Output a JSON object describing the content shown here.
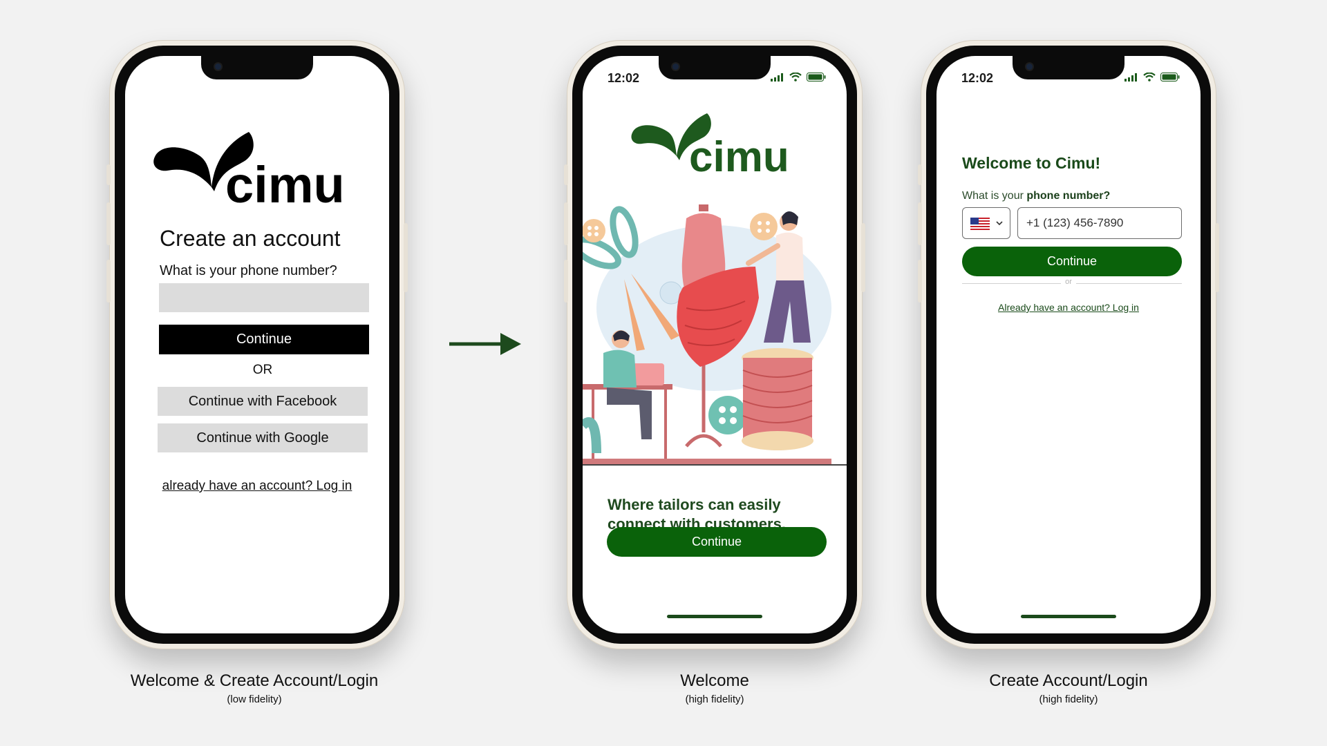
{
  "colors": {
    "brand_green": "#0a620a",
    "dark_green": "#1a4a1a",
    "background": "#f2f2f2"
  },
  "screens": {
    "lowfi": {
      "logo_text": "cimu",
      "title": "Create an account",
      "question": "What is your phone number?",
      "continue_label": "Continue",
      "or_label": "OR",
      "facebook_label": "Continue with Facebook",
      "google_label": "Continue with Google",
      "login_link": "already have an account? Log in",
      "caption": "Welcome & Create Account/Login",
      "caption_sub": "(low fidelity)"
    },
    "welcome": {
      "time": "12:02",
      "logo_text": "cimu",
      "tagline": "Where tailors can easily connect with customers.",
      "continue_label": "Continue",
      "caption": "Welcome",
      "caption_sub": "(high fidelity)"
    },
    "create": {
      "time": "12:02",
      "title": "Welcome to Cimu!",
      "question_prefix": "What is your ",
      "question_bold": "phone number?",
      "country_flag": "us-flag-icon",
      "phone_value": "+1 (123) 456-7890",
      "continue_label": "Continue",
      "or_label": "or",
      "login_link": "Already have an account? Log in",
      "caption": "Create Account/Login",
      "caption_sub": "(high fidelity)"
    }
  },
  "flow_arrow": "arrow-right-icon"
}
